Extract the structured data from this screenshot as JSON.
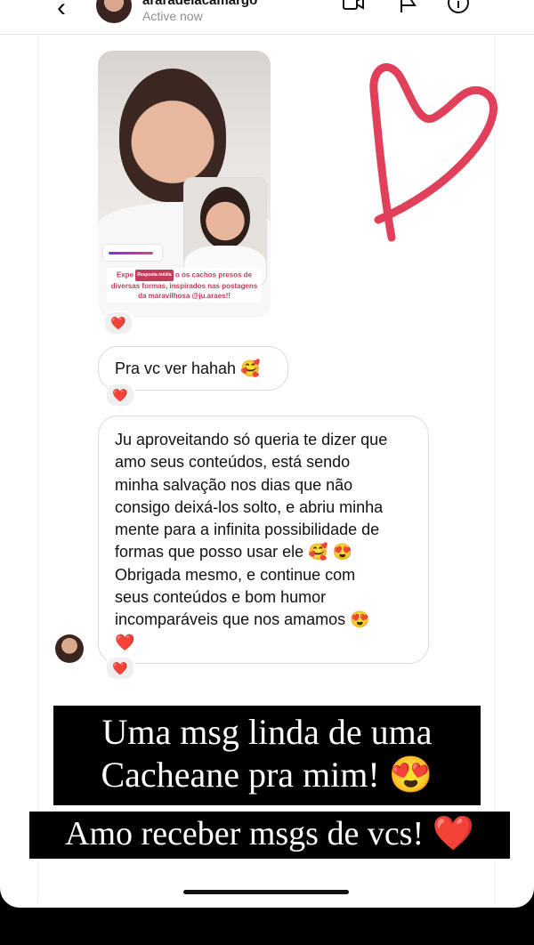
{
  "header": {
    "username": "araradelacamargo",
    "status": "Active now",
    "back_icon": "‹"
  },
  "story": {
    "poll_tag": "Resposta média",
    "caption_prefix": "Expe",
    "caption_text": "o os cachos presos de diversas formas, inspirados nas postagens da maravilhosa @ju.araes!!"
  },
  "messages": [
    {
      "text": "Pra vc ver hahah 🥰",
      "reaction": "❤️"
    },
    {
      "text": "Ju aproveitando só queria te dizer que\namo seus conteúdos, está sendo\nminha salvação nos dias que não\nconsigo deixá-los solto, e abriu minha\nmente para a infinita possibilidade de\nformas que posso usar ele 🥰 😍\nObrigada mesmo, e continue com\nseus conteúdos e bom humor\nincomparáveis que nos amamos 😍\n❤️",
      "reaction": "❤️"
    }
  ],
  "story_reaction": "❤️",
  "overlay": {
    "line1": "Uma msg linda de uma",
    "line2": "Cacheane pra mim! 😍",
    "line3": "Amo receber msgs de vcs! ❤️"
  },
  "colors": {
    "drawn_heart": "#e0405a",
    "caption": "#c23b5a"
  }
}
